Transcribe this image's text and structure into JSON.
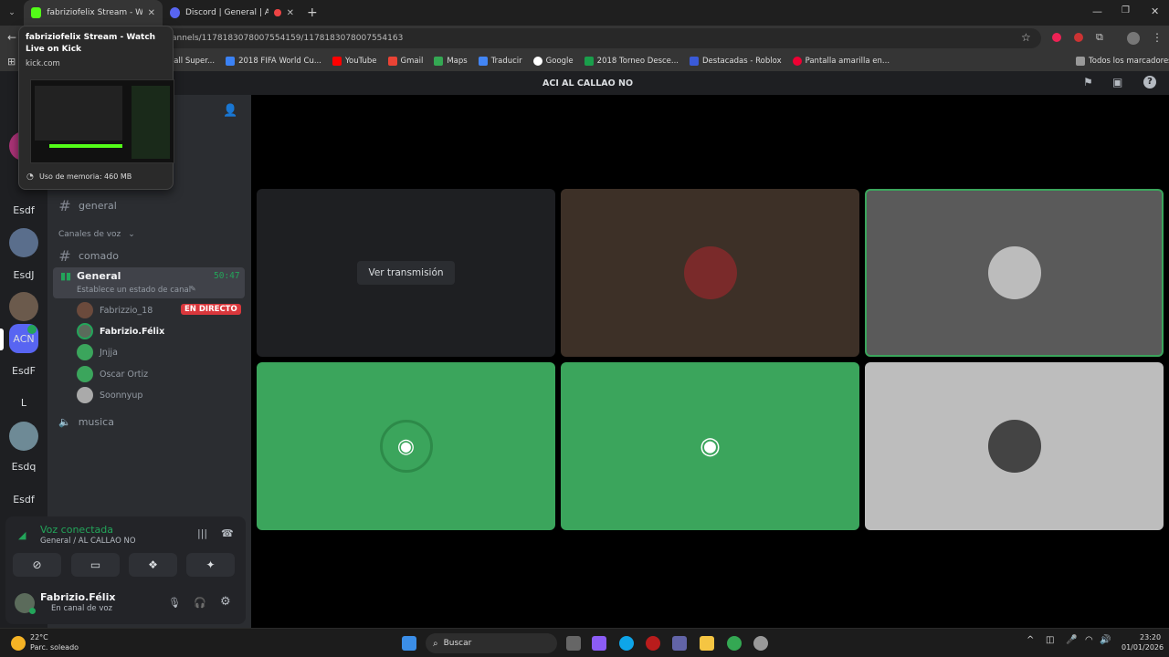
{
  "browser": {
    "tabs": [
      {
        "title": "fabriziofelix Stream - Watch Live",
        "active": true
      },
      {
        "title": "Discord | General | AL CALL",
        "active": false
      }
    ],
    "url": "annels/1178183078007554159/1178183078007554163",
    "bookmarks": [
      "all Super...",
      "2018 FIFA World Cu...",
      "YouTube",
      "Gmail",
      "Maps",
      "Traducir",
      "Google",
      "2018 Torneo Desce...",
      "Destacadas - Roblox",
      "Pantalla amarilla en..."
    ],
    "all_bookmarks": "Todos los marcadores"
  },
  "tooltip": {
    "title": "fabriziofelix Stream - Watch Live on Kick",
    "domain": "kick.com",
    "memory": "Uso de memoria: 460 MB"
  },
  "discord": {
    "server_header": "ACI AL CALLAO NO",
    "servers": [
      "Esdf",
      "EsdJ",
      "ACN",
      "EsdF",
      "L",
      "Esdq",
      "Esdf"
    ],
    "text_channel_general": "general",
    "voice_category": "Canales de voz",
    "channels": {
      "comado": "comado",
      "general_voice": "General",
      "general_time": "50:47",
      "status_prompt": "Establece un estado de canal",
      "musica": "musica"
    },
    "members": [
      {
        "name": "Fabrizzio_18",
        "badge": "EN DIRECTO"
      },
      {
        "name": "Fabrizio.Félix",
        "badge": ""
      },
      {
        "name": "Jnjja",
        "badge": ""
      },
      {
        "name": "Oscar Ortiz",
        "badge": ""
      },
      {
        "name": "Soonnyup",
        "badge": ""
      }
    ],
    "watch_button": "Ver transmisión",
    "voice_panel": {
      "status": "Voz conectada",
      "location": "General / AL CALLAO NO"
    },
    "user": {
      "name": "Fabrizio.Félix",
      "status": "En canal de voz"
    }
  },
  "taskbar": {
    "weather_temp": "22°C",
    "weather_desc": "Parc. soleado",
    "search": "Buscar",
    "time": "23:20",
    "date": "01/01/2026"
  },
  "colors": {
    "green_tile": "#3ba55c",
    "live_red": "#da373c",
    "voice_green": "#23a55a"
  }
}
